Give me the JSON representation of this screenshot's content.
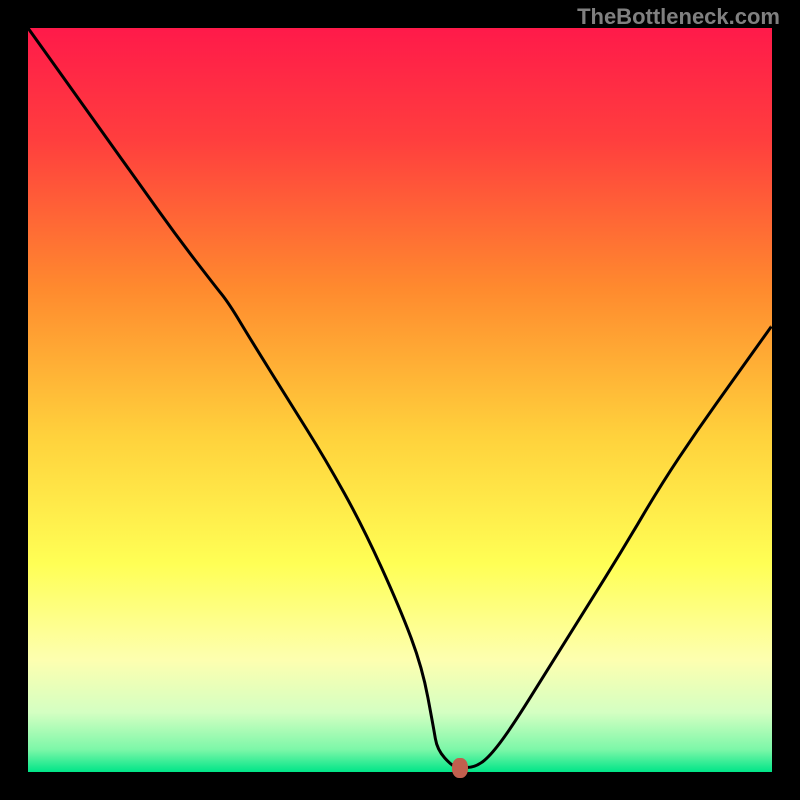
{
  "watermark": "TheBottleneck.com",
  "chart_data": {
    "type": "line",
    "title": "",
    "xlabel": "",
    "ylabel": "",
    "xlim": [
      0,
      100
    ],
    "ylim": [
      0,
      100
    ],
    "grid": false,
    "gradient_stops": [
      {
        "offset": 0,
        "color": "#ff1a4a"
      },
      {
        "offset": 15,
        "color": "#ff3e3e"
      },
      {
        "offset": 35,
        "color": "#ff8a2e"
      },
      {
        "offset": 55,
        "color": "#ffd23c"
      },
      {
        "offset": 72,
        "color": "#ffff55"
      },
      {
        "offset": 85,
        "color": "#fdffb0"
      },
      {
        "offset": 92,
        "color": "#d4ffc2"
      },
      {
        "offset": 97,
        "color": "#7cf7a8"
      },
      {
        "offset": 100,
        "color": "#00e588"
      }
    ],
    "series": [
      {
        "name": "bottleneck-curve",
        "color": "#000000",
        "x": [
          0.0,
          5,
          10,
          15,
          20,
          25,
          27,
          30,
          35,
          40,
          45,
          50,
          53,
          54.5,
          55,
          57,
          58,
          60,
          62,
          65,
          70,
          75,
          80,
          85,
          90,
          95,
          100
        ],
        "y": [
          100.0,
          93,
          86,
          79,
          72,
          65.5,
          63,
          58,
          50,
          42,
          33,
          22,
          14,
          6,
          3,
          0.8,
          0.6,
          0.6,
          2,
          6,
          14,
          22,
          30,
          38.5,
          46,
          53,
          60
        ]
      }
    ],
    "marker": {
      "x": 58,
      "y": 0.6,
      "color": "#c15f4e"
    }
  }
}
